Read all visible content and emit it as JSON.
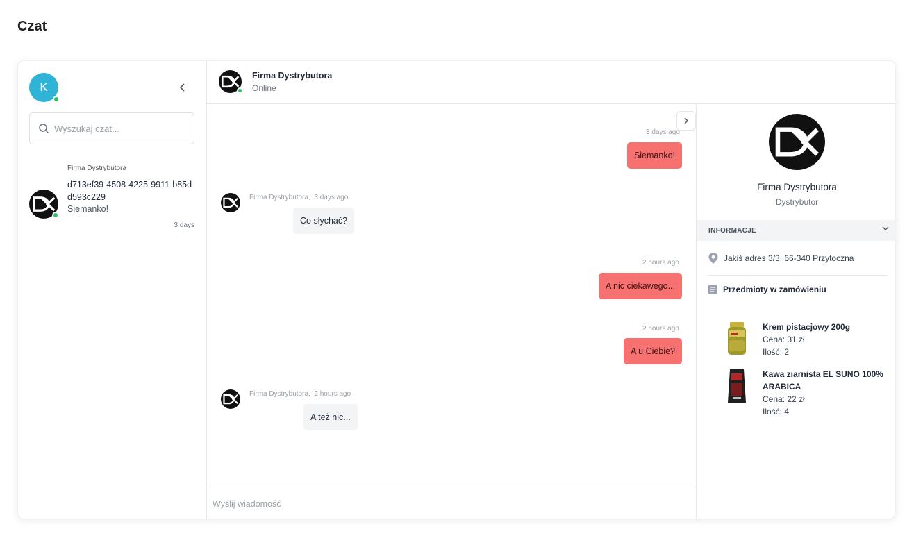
{
  "page": {
    "title": "Czat"
  },
  "sidebar": {
    "user_initial": "K",
    "search_placeholder": "Wyszukaj czat...",
    "conversations": [
      {
        "name": "Firma Dystrybutora",
        "id": "d713ef39-4508-4225-9911-b85dd593c229",
        "last_message": "Siemanko!",
        "time": "3 days"
      }
    ]
  },
  "chat": {
    "contact_name": "Firma Dystrybutora",
    "contact_status": "Online",
    "composer_placeholder": "Wyślij wiadomość",
    "messages": [
      {
        "direction": "out",
        "time": "3 days ago",
        "text": "Siemanko!"
      },
      {
        "direction": "in",
        "sender": "Firma Dystrybutora,",
        "time": "3 days ago",
        "text": "Co słychać?"
      },
      {
        "direction": "out",
        "time": "2 hours ago",
        "text": "A nic ciekawego..."
      },
      {
        "direction": "out",
        "time": "2 hours ago",
        "text": "A u Ciebie?"
      },
      {
        "direction": "in",
        "sender": "Firma Dystrybutora,",
        "time": "2 hours ago",
        "text": "A też nic..."
      }
    ]
  },
  "details": {
    "name": "Firma Dystrybutora",
    "role": "Dystrybutor",
    "section_title": "INFORMACJE",
    "address": "Jakiś adres 3/3, 66-340 Przytoczna",
    "items_title": "Przedmioty w zamówieniu",
    "products": [
      {
        "name": "Krem pistacjowy 200g",
        "price": "Cena: 31 zł",
        "quantity": "Ilość: 2"
      },
      {
        "name": "Kawa ziarnista EL SUNO 100% ARABICA",
        "price": "Cena: 22 zł",
        "quantity": "Ilość: 4"
      }
    ]
  },
  "colors": {
    "accent_outgoing": "#f87171",
    "avatar_user": "#2fb3d6",
    "online": "#22c55e"
  },
  "icons": [
    "chevron-left-icon",
    "search-icon",
    "chevron-right-icon",
    "chevron-down-icon",
    "location-pin-icon",
    "list-icon",
    "dk-logo"
  ]
}
